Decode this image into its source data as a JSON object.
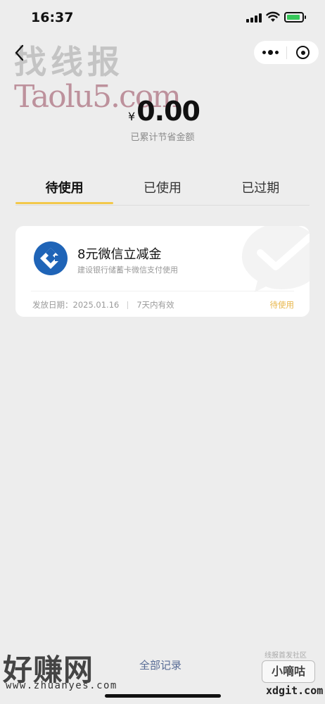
{
  "status_bar": {
    "time": "16:37"
  },
  "watermarks": {
    "top_cn": "找线报",
    "taolu": "Taolu5.com",
    "haozhuan": "好赚网",
    "haozhuan_url": "www.zhuanyes.com",
    "xdg_top": "线报首发社区",
    "xdg_name": "小嘀咕",
    "xdg_url": "xdgit.com"
  },
  "summary": {
    "currency": "¥",
    "amount": "0.00",
    "label": "已累计节省金额"
  },
  "tabs": [
    {
      "label": "待使用",
      "active": true
    },
    {
      "label": "已使用",
      "active": false
    },
    {
      "label": "已过期",
      "active": false
    }
  ],
  "coupons": [
    {
      "title": "8元微信立减金",
      "subtitle": "建设银行储蓄卡微信支付使用",
      "issue_date": "发放日期：2025.01.16",
      "validity": "7天内有效",
      "status": "待使用"
    }
  ],
  "footer": {
    "all_records": "全部记录"
  },
  "colors": {
    "background": "#ededed",
    "tab_underline": "#f2c84b",
    "status_pending": "#e8b64a",
    "link": "#576b95",
    "ccb_blue": "#1f64b7"
  },
  "icons": [
    "back-icon",
    "more-icon",
    "close-miniprogram-icon",
    "ccb-bank-logo-icon",
    "wechat-pay-watermark-icon"
  ]
}
